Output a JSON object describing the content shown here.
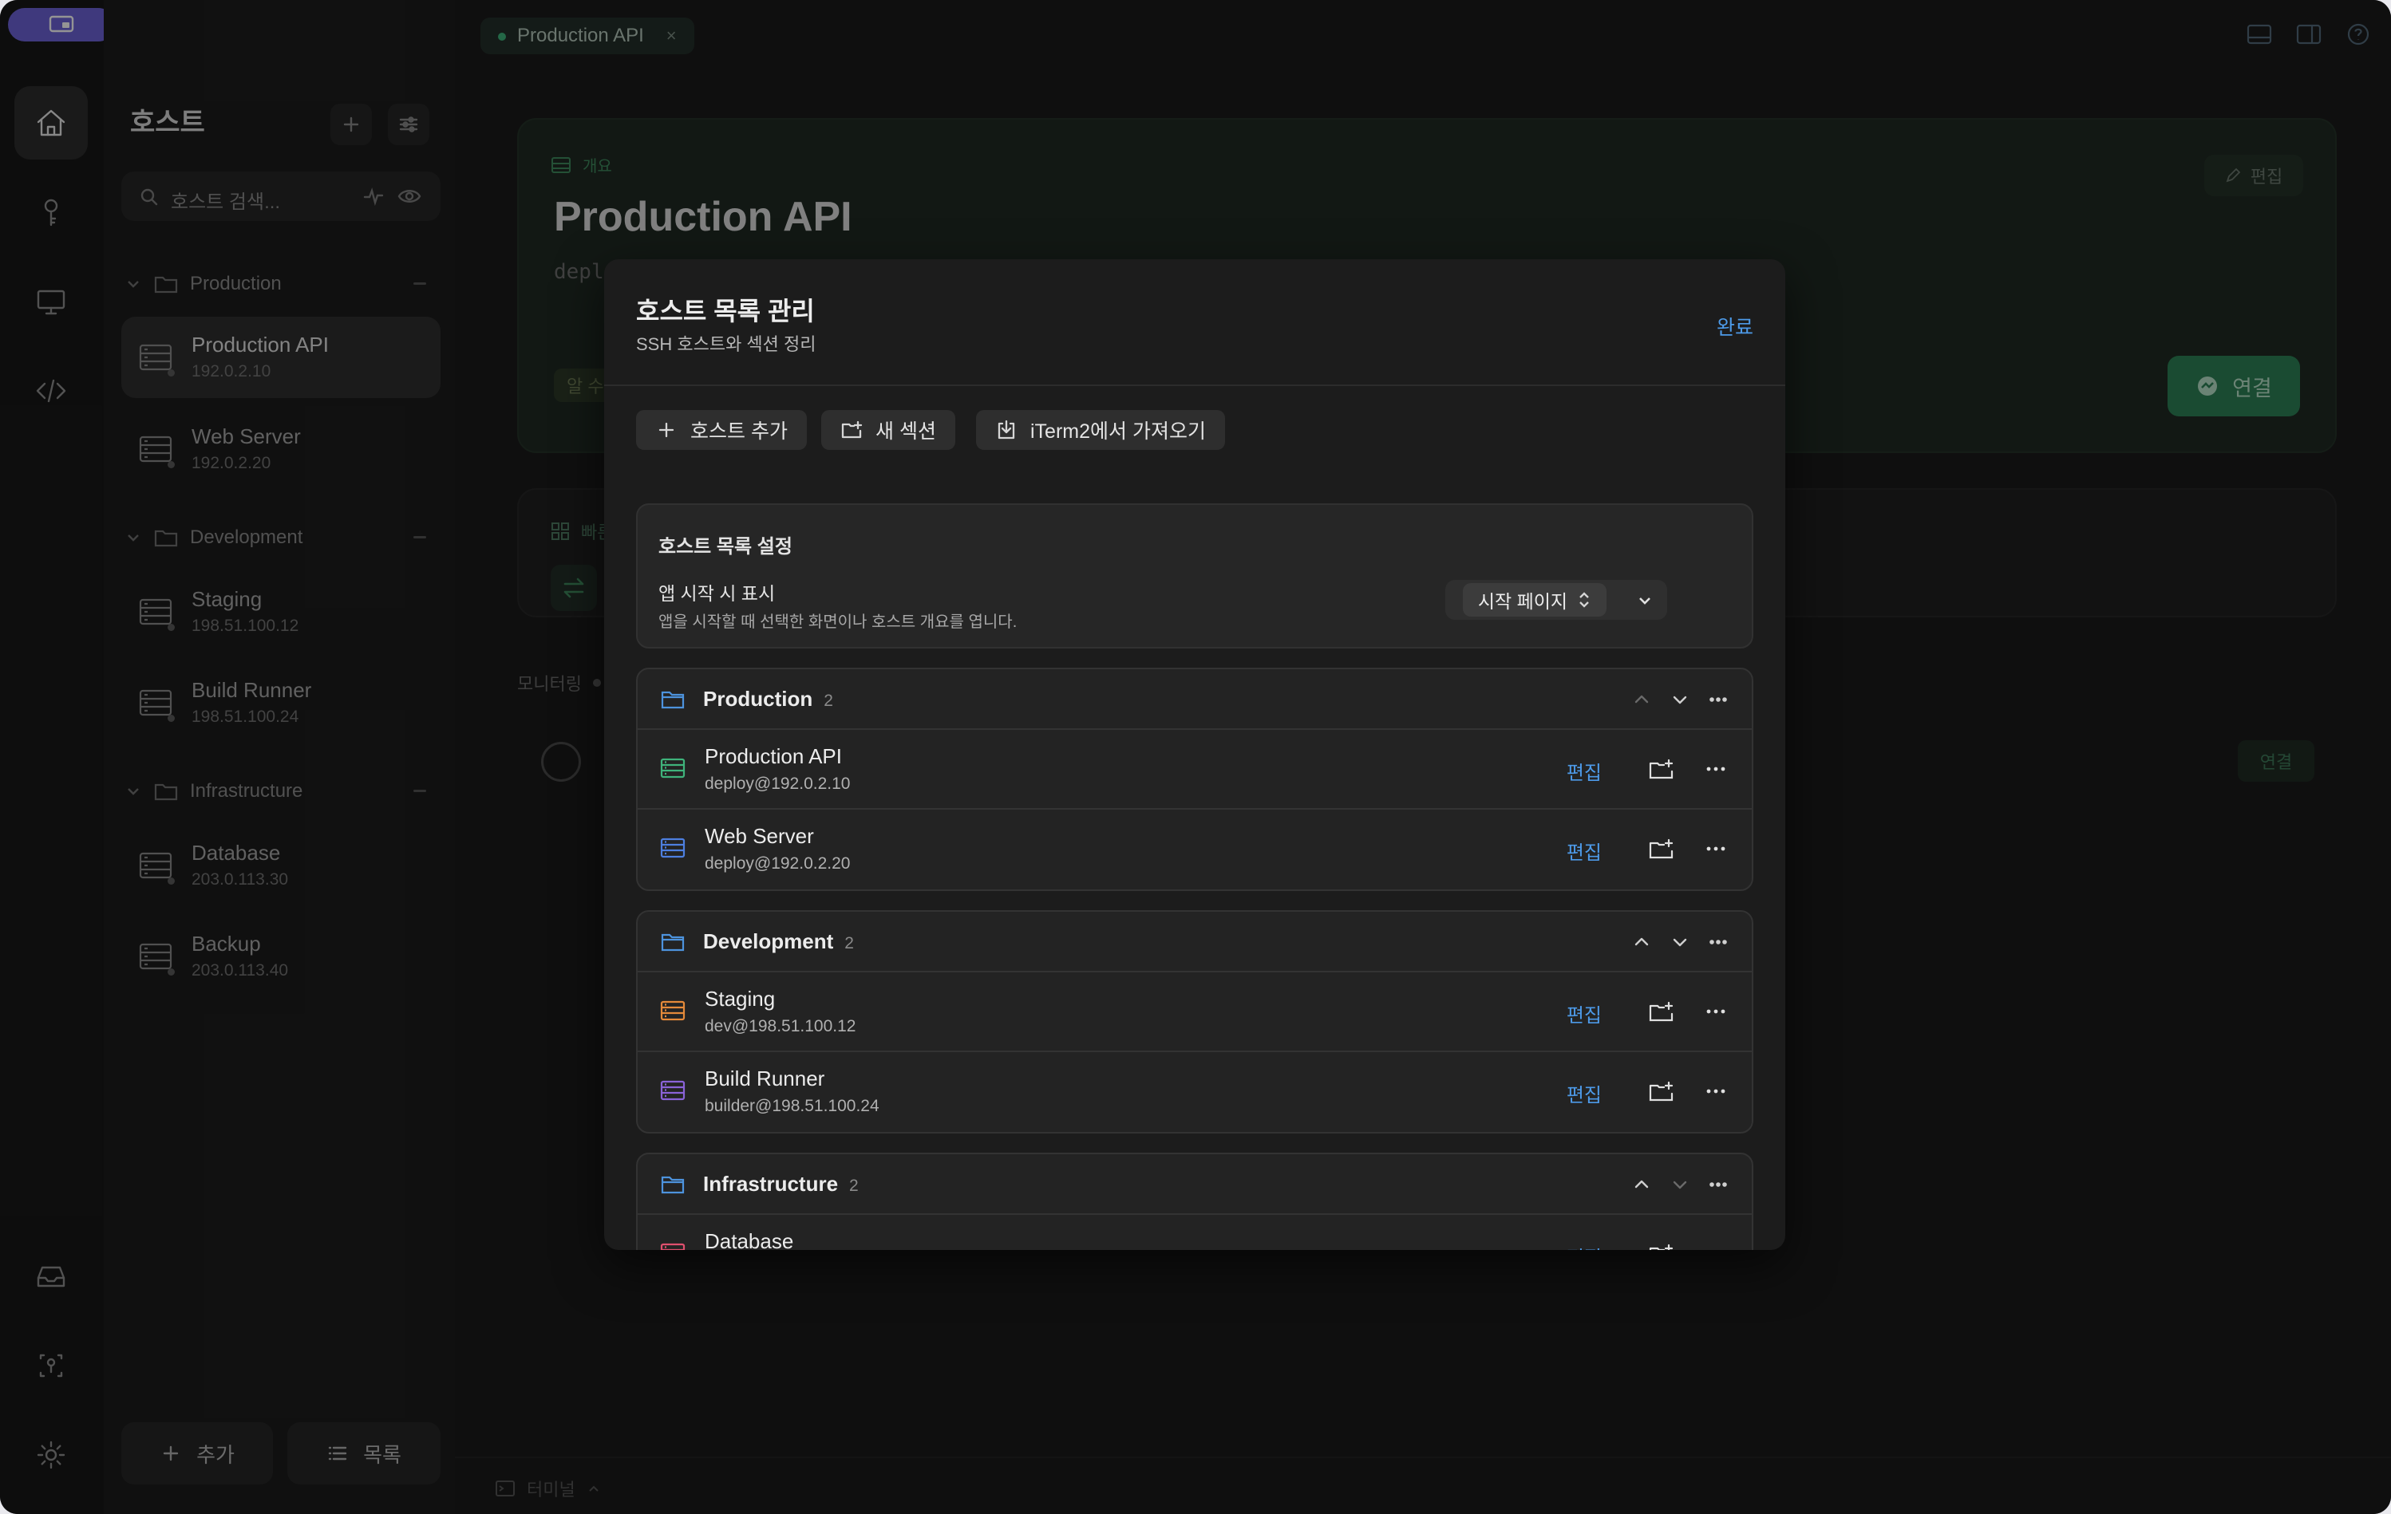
{
  "tab": {
    "title": "Production API",
    "close": "×"
  },
  "sidebar": {
    "title": "호스트",
    "search_placeholder": "호스트 검색...",
    "groups": [
      {
        "name": "Production",
        "hosts": [
          {
            "name": "Production API",
            "ip": "192.0.2.10",
            "selected": true
          },
          {
            "name": "Web Server",
            "ip": "192.0.2.20"
          }
        ]
      },
      {
        "name": "Development",
        "hosts": [
          {
            "name": "Staging",
            "ip": "198.51.100.12"
          },
          {
            "name": "Build Runner",
            "ip": "198.51.100.24"
          }
        ]
      },
      {
        "name": "Infrastructure",
        "hosts": [
          {
            "name": "Database",
            "ip": "203.0.113.30"
          },
          {
            "name": "Backup",
            "ip": "203.0.113.40"
          }
        ]
      }
    ],
    "add_label": "추가",
    "list_label": "목록"
  },
  "detail": {
    "overview_label": "개요",
    "title": "Production API",
    "subtitle": "deplo",
    "edit_label": "편집",
    "connect_label": "연결",
    "chip_label": "알 수",
    "quick_label": "빠른",
    "monitoring_label": "모니터링",
    "connect2_label": "연결",
    "terminal_label": "터미널"
  },
  "modal": {
    "title": "호스트 목록 관리",
    "subtitle": "SSH 호스트와 섹션 정리",
    "done": "완료",
    "toolbar": {
      "add_host": "호스트 추가",
      "new_section": "새 섹션",
      "import_iterm": "iTerm2에서 가져오기"
    },
    "settings": {
      "heading": "호스트 목록 설정",
      "startup_label": "앱 시작 시 표시",
      "startup_desc": "앱을 시작할 때 선택한 화면이나 호스트 개요를 엽니다.",
      "startup_value": "시작 페이지"
    },
    "edit_label": "편집",
    "sections": [
      {
        "name": "Production",
        "count": "2",
        "up_enabled": false,
        "hosts": [
          {
            "name": "Production API",
            "user": "deploy@192.0.2.10",
            "color": "#3fb37b"
          },
          {
            "name": "Web Server",
            "user": "deploy@192.0.2.20",
            "color": "#4d7fe0"
          }
        ]
      },
      {
        "name": "Development",
        "count": "2",
        "up_enabled": true,
        "hosts": [
          {
            "name": "Staging",
            "user": "dev@198.51.100.12",
            "color": "#e58a3a"
          },
          {
            "name": "Build Runner",
            "user": "builder@198.51.100.24",
            "color": "#8a63d8"
          }
        ]
      },
      {
        "name": "Infrastructure",
        "count": "2",
        "up_enabled": true,
        "down_enabled": false,
        "hosts": [
          {
            "name": "Database",
            "user": "",
            "color": "#e0506e"
          }
        ]
      }
    ]
  },
  "colors": {
    "accent": "#4d9ae8",
    "connect": "#2d8156",
    "brand": "#6d63d8"
  }
}
